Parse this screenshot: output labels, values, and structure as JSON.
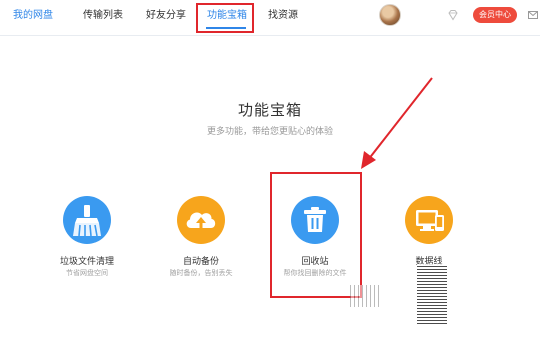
{
  "nav": {
    "items": [
      "我的网盘",
      "传输列表",
      "好友分享",
      "功能宝箱",
      "找资源"
    ],
    "vip_label": "会员中心"
  },
  "main": {
    "title": "功能宝箱",
    "subtitle": "更多功能，带给您更贴心的体验"
  },
  "tools": [
    {
      "name": "垃圾文件清理",
      "desc": "节省网盘空间",
      "icon": "broom-icon",
      "color": "#3a9af0"
    },
    {
      "name": "自动备份",
      "desc": "随时备份，告别丢失",
      "icon": "cloud-upload-icon",
      "color": "#f7a51c"
    },
    {
      "name": "回收站",
      "desc": "帮你找回删除的文件",
      "icon": "trash-icon",
      "color": "#3a9af0"
    },
    {
      "name": "数据线",
      "desc": "",
      "icon": "devices-icon",
      "color": "#f7a51c"
    }
  ],
  "colors": {
    "accent": "#2f86e8",
    "highlight_red": "#e0262c",
    "vip_red": "#ee4b3c"
  }
}
